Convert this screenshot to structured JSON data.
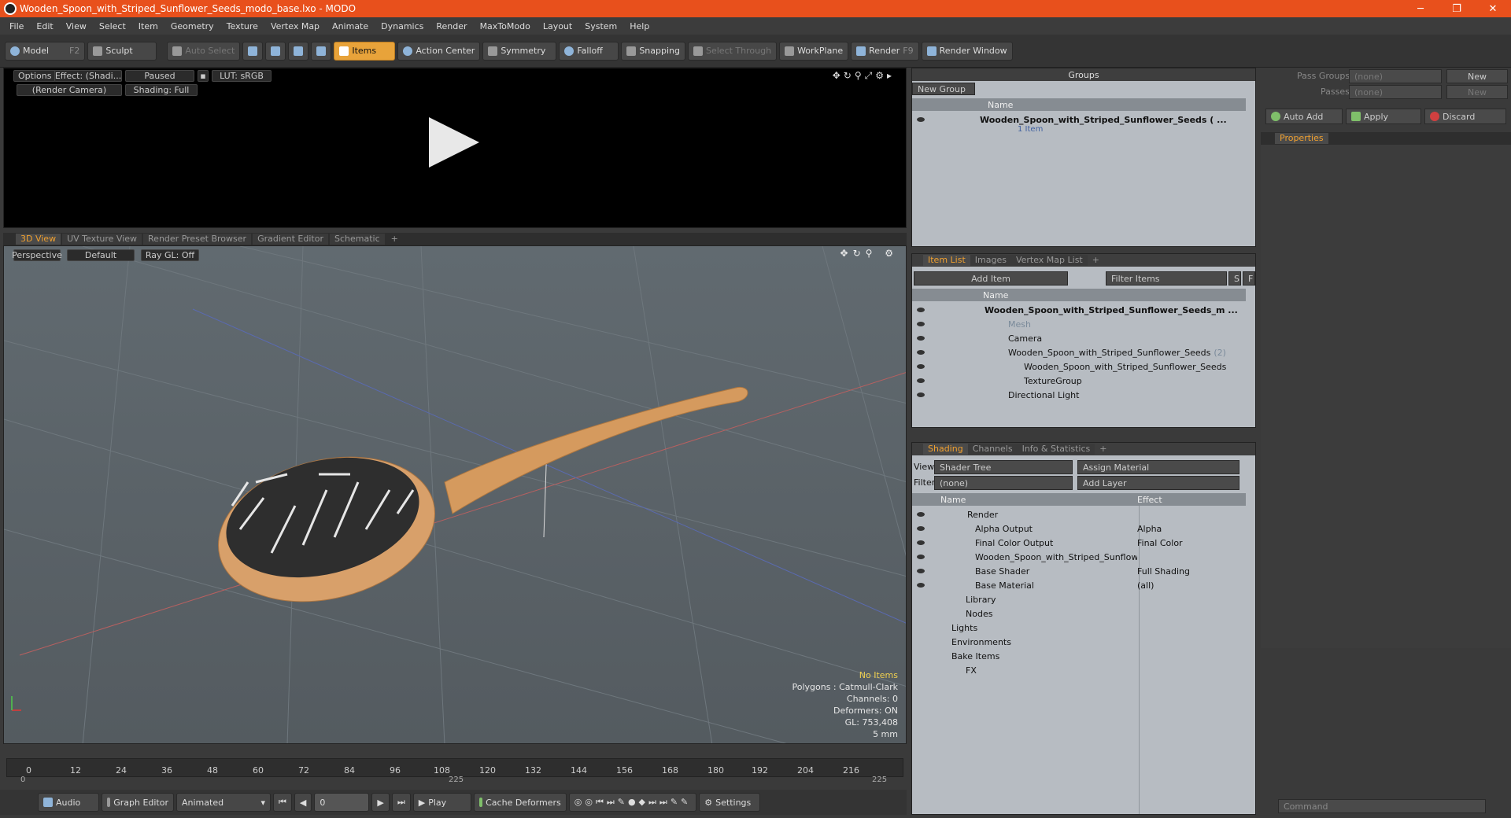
{
  "window": {
    "title": "Wooden_Spoon_with_Striped_Sunflower_Seeds_modo_base.lxo - MODO",
    "minimize": "─",
    "maximize": "❐",
    "close": "✕"
  },
  "menu": [
    "File",
    "Edit",
    "View",
    "Select",
    "Item",
    "Geometry",
    "Texture",
    "Vertex Map",
    "Animate",
    "Dynamics",
    "Render",
    "MaxToModo",
    "Layout",
    "System",
    "Help"
  ],
  "toolbar": {
    "model": "Model",
    "model_key": "F2",
    "sculpt": "Sculpt",
    "auto_select": "Auto Select",
    "items": "Items",
    "action_center": "Action Center",
    "symmetry": "Symmetry",
    "falloff": "Falloff",
    "snapping": "Snapping",
    "select_through": "Select Through",
    "workplane": "WorkPlane",
    "render": "Render",
    "render_key": "F9",
    "render_window": "Render Window"
  },
  "preview": {
    "options": "Options",
    "effect": "Effect: (Shadi...",
    "paused": "Paused",
    "lut": "LUT: sRGB",
    "camera": "(Render Camera)",
    "shading": "Shading: Full"
  },
  "viewport_tabs": [
    "3D View",
    "UV Texture View",
    "Render Preset Browser",
    "Gradient Editor",
    "Schematic",
    "+"
  ],
  "viewport": {
    "perspective": "Perspective",
    "default": "Default",
    "raygl": "Ray GL: Off",
    "info": {
      "no_items": "No Items",
      "polygons": "Polygons : Catmull-Clark",
      "channels": "Channels: 0",
      "deformers": "Deformers: ON",
      "gl": "GL: 753,408",
      "scale": "5 mm"
    }
  },
  "timeline": {
    "ticks": [
      "0",
      "12",
      "24",
      "36",
      "48",
      "60",
      "72",
      "84",
      "96",
      "108",
      "120",
      "132",
      "144",
      "156",
      "168",
      "180",
      "192",
      "204",
      "216"
    ],
    "start": "0",
    "mid": "225",
    "end": "225"
  },
  "bottom": {
    "audio": "Audio",
    "graph_editor": "Graph Editor",
    "animated": "Animated",
    "frame": "0",
    "play": "Play",
    "cache_deformers": "Cache Deformers",
    "settings": "Settings"
  },
  "groups": {
    "header": "Groups",
    "new_group": "New Group",
    "col_name": "Name",
    "item_name": "Wooden_Spoon_with_Striped_Sunflower_Seeds ( ...",
    "item_count": "1 Item"
  },
  "item_list": {
    "tabs": [
      "Item List",
      "Images",
      "Vertex Map List",
      "+"
    ],
    "add_item": "Add Item",
    "filter_items": "Filter Items",
    "s": "S",
    "f": "F",
    "col_name": "Name",
    "rows": [
      {
        "label": "Wooden_Spoon_with_Striped_Sunflower_Seeds_m ...",
        "indent": 0
      },
      {
        "label": "Mesh",
        "indent": 1
      },
      {
        "label": "Camera",
        "indent": 1
      },
      {
        "label": "Wooden_Spoon_with_Striped_Sunflower_Seeds",
        "suffix": "(2)",
        "indent": 1
      },
      {
        "label": "Wooden_Spoon_with_Striped_Sunflower_Seeds",
        "indent": 2
      },
      {
        "label": "TextureGroup",
        "indent": 2
      },
      {
        "label": "Directional Light",
        "indent": 1
      }
    ]
  },
  "shading": {
    "tabs": [
      "Shading",
      "Channels",
      "Info & Statistics",
      "+"
    ],
    "view_label": "View",
    "view_value": "Shader Tree",
    "assign_material": "Assign Material",
    "filter_label": "Filter",
    "filter_value": "(none)",
    "add_layer": "Add Layer",
    "col_name": "Name",
    "col_effect": "Effect",
    "rows": [
      {
        "name": "Render",
        "effect": ""
      },
      {
        "name": "Alpha Output",
        "effect": "Alpha"
      },
      {
        "name": "Final Color Output",
        "effect": "Final Color"
      },
      {
        "name": "Wooden_Spoon_with_Striped_Sunflowe ...",
        "effect": ""
      },
      {
        "name": "Base Shader",
        "effect": "Full Shading"
      },
      {
        "name": "Base Material",
        "effect": "(all)"
      },
      {
        "name": "Library",
        "effect": ""
      },
      {
        "name": "Nodes",
        "effect": ""
      },
      {
        "name": "Lights",
        "effect": ""
      },
      {
        "name": "Environments",
        "effect": ""
      },
      {
        "name": "Bake Items",
        "effect": ""
      },
      {
        "name": "FX",
        "effect": ""
      }
    ]
  },
  "properties": {
    "pass_groups_label": "Pass Groups",
    "pass_groups_value": "(none)",
    "new": "New",
    "passes_label": "Passes",
    "passes_value": "(none)",
    "auto_add": "Auto Add",
    "apply": "Apply",
    "discard": "Discard",
    "tab": "Properties",
    "command_placeholder": "Command"
  }
}
